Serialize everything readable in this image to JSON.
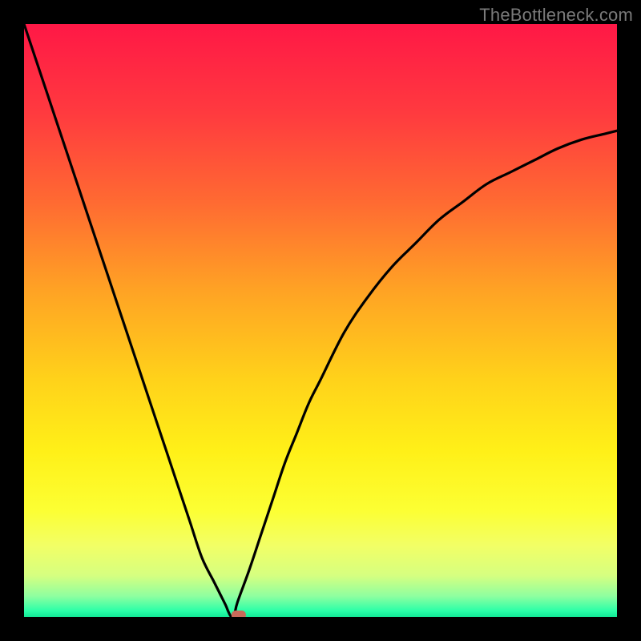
{
  "watermark": "TheBottleneck.com",
  "chart_data": {
    "type": "line",
    "title": "",
    "xlabel": "",
    "ylabel": "",
    "xlim": [
      0,
      1
    ],
    "ylim": [
      0,
      100
    ],
    "series": [
      {
        "name": "curve",
        "x": [
          0.0,
          0.02,
          0.04,
          0.06,
          0.08,
          0.1,
          0.12,
          0.14,
          0.16,
          0.18,
          0.2,
          0.22,
          0.24,
          0.26,
          0.28,
          0.3,
          0.32,
          0.33,
          0.34,
          0.345,
          0.35,
          0.355,
          0.36,
          0.38,
          0.4,
          0.42,
          0.44,
          0.46,
          0.48,
          0.5,
          0.54,
          0.58,
          0.62,
          0.66,
          0.7,
          0.74,
          0.78,
          0.82,
          0.86,
          0.9,
          0.94,
          0.98,
          1.0
        ],
        "values": [
          100,
          94,
          88,
          82,
          76,
          70,
          64,
          58,
          52,
          46,
          40,
          34,
          28,
          22,
          16,
          10,
          6,
          4,
          2,
          0.8,
          0,
          0.5,
          2.5,
          8,
          14,
          20,
          26,
          31,
          36,
          40,
          48,
          54,
          59,
          63,
          67,
          70,
          73,
          75,
          77,
          79,
          80.5,
          81.5,
          82
        ]
      }
    ],
    "marker": {
      "x": 0.362,
      "y": 0
    },
    "background": {
      "type": "vertical-gradient",
      "stops": [
        {
          "pos": 0.0,
          "color": "#ff1846"
        },
        {
          "pos": 0.15,
          "color": "#ff3a3f"
        },
        {
          "pos": 0.3,
          "color": "#ff6a32"
        },
        {
          "pos": 0.45,
          "color": "#ffa324"
        },
        {
          "pos": 0.6,
          "color": "#ffd21a"
        },
        {
          "pos": 0.72,
          "color": "#fff018"
        },
        {
          "pos": 0.82,
          "color": "#fcff33"
        },
        {
          "pos": 0.88,
          "color": "#f2ff66"
        },
        {
          "pos": 0.93,
          "color": "#d6ff80"
        },
        {
          "pos": 0.965,
          "color": "#8effa0"
        },
        {
          "pos": 0.99,
          "color": "#2affa8"
        },
        {
          "pos": 1.0,
          "color": "#12e896"
        }
      ]
    }
  }
}
